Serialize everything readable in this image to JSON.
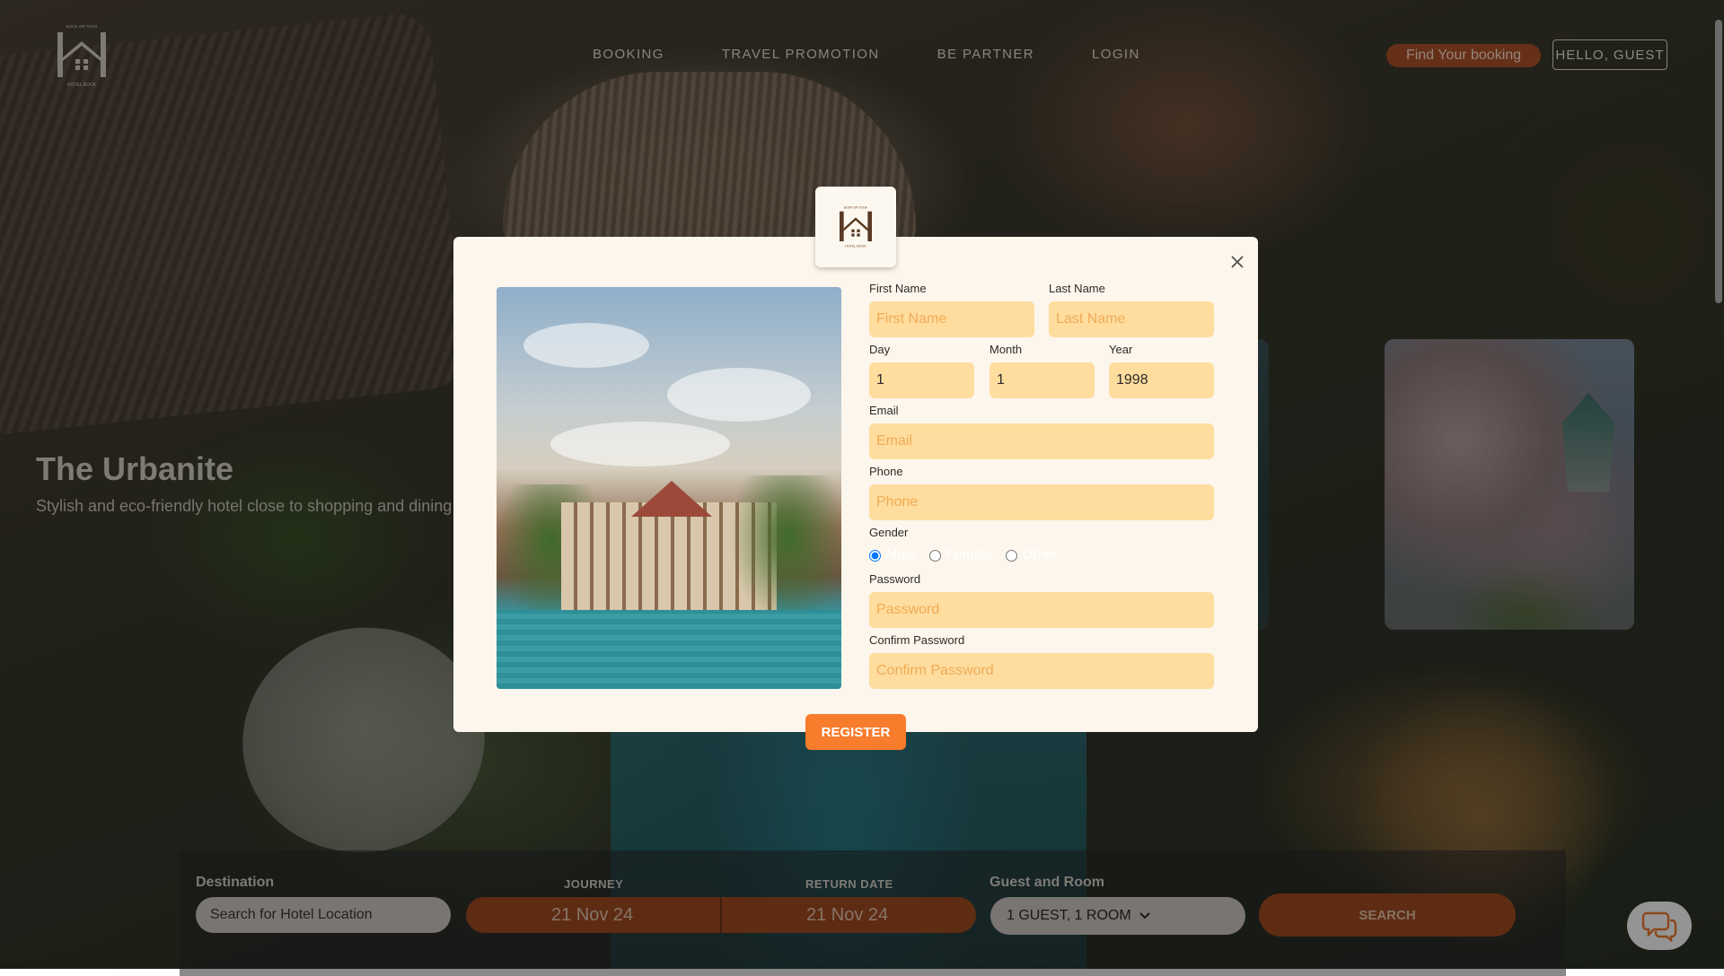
{
  "header": {
    "logo_text_top": "BOOK OR TOUR",
    "logo_text_bottom": "HOTEL BOOK",
    "nav": [
      "BOOKING",
      "TRAVEL PROMOTION",
      "BE PARTNER",
      "LOGIN"
    ],
    "find_booking": "Find Your booking",
    "greeting": "HELLO, GUEST"
  },
  "hero": {
    "title": "The Urbanite",
    "subtitle": "Stylish and eco-friendly hotel close to shopping and dining"
  },
  "booking_bar": {
    "destination_label": "Destination",
    "destination_placeholder": "Search for Hotel Location",
    "journey_label": "JOURNEY",
    "journey_value": "21 Nov 24",
    "return_label": "RETURN DATE",
    "return_value": "21 Nov 24",
    "guest_label": "Guest and Room",
    "guest_value": "1 GUEST, 1 ROOM",
    "search_label": "SEARCH"
  },
  "modal": {
    "logo_text_top": "BOOK OR TOUR",
    "logo_text_bottom": "HOTEL BOOK",
    "first_name_label": "First Name",
    "first_name_placeholder": "First Name",
    "last_name_label": "Last Name",
    "last_name_placeholder": "Last Name",
    "day_label": "Day",
    "day_value": "1",
    "month_label": "Month",
    "month_value": "1",
    "year_label": "Year",
    "year_value": "1998",
    "email_label": "Email",
    "email_placeholder": "Email",
    "phone_label": "Phone",
    "phone_placeholder": "Phone",
    "gender_label": "Gender",
    "gender_options": [
      "Male",
      "Female",
      "Other"
    ],
    "gender_selected": "Male",
    "password_label": "Password",
    "password_placeholder": "Password",
    "confirm_label": "Confirm Password",
    "confirm_placeholder": "Confirm Password",
    "register_label": "REGISTER"
  },
  "icons": {
    "close": "close-icon",
    "chevron": "chevron-down-icon",
    "chat": "chat-bubbles-icon"
  },
  "colors": {
    "accent_orange": "#f77c2c",
    "input_fill": "#fedd9e",
    "placeholder": "#f0ab56",
    "modal_bg": "#fdf6ec",
    "rust": "#a24d22"
  }
}
